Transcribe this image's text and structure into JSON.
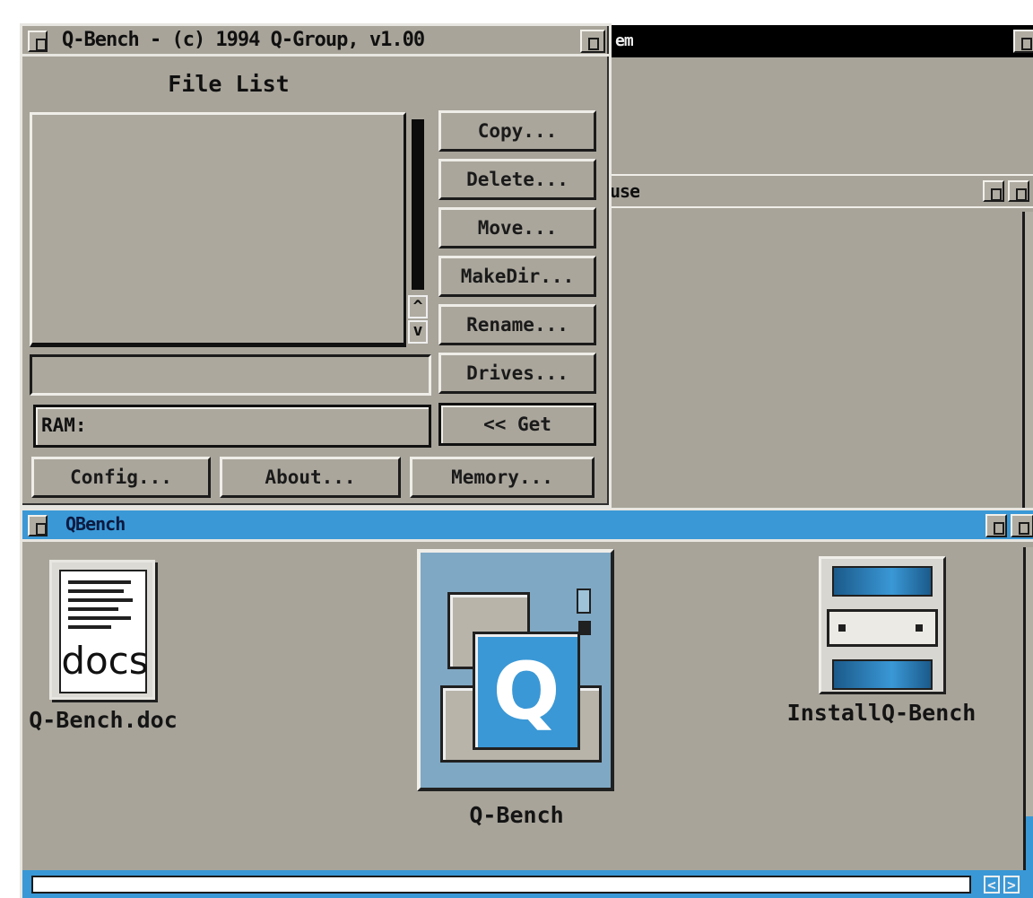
{
  "qbench_window": {
    "title": "Q-Bench - (c) 1994 Q-Group, v1.00",
    "file_list_heading": "File List",
    "buttons": {
      "copy": "Copy...",
      "delete": "Delete...",
      "move": "Move...",
      "makedir": "MakeDir...",
      "rename": "Rename...",
      "drives": "Drives...",
      "get": "<< Get"
    },
    "name_field_value": "",
    "path_field_value": "RAM:",
    "bottom_buttons": {
      "config": "Config...",
      "about": "About...",
      "memory": "Memory..."
    }
  },
  "background_windows": {
    "top_title_fragment": "em",
    "middle_title_fragment": "use"
  },
  "qbench_drawer": {
    "title": "QBench",
    "icons": [
      {
        "label": "Q-Bench.doc",
        "icon": "document-icon",
        "icon_text": "docs"
      },
      {
        "label": "Q-Bench",
        "icon": "qbench-app-icon",
        "icon_text": "Q"
      },
      {
        "label": "InstallQ-Bench",
        "icon": "installer-drive-icon"
      }
    ]
  },
  "colors": {
    "window_gray": "#a8a49a",
    "active_title_blue": "#3a98d6",
    "inactive_title_black": "#000000"
  }
}
